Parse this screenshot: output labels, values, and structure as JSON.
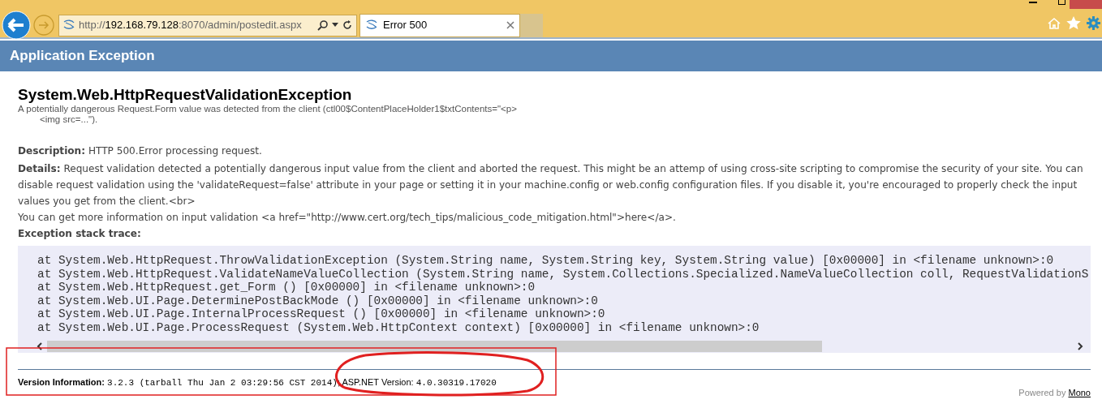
{
  "browser": {
    "address": {
      "scheme": "http://",
      "host": "192.168.79.128",
      "rest": ":8070/admin/postedit.aspx"
    },
    "tabs": [
      {
        "label": "Error 500",
        "selected": true
      }
    ]
  },
  "header": {
    "title": "Application Exception"
  },
  "exception": {
    "name": "System.Web.HttpRequestValidationException",
    "message_lines": [
      "A potentially dangerous Request.Form value was detected from the client (ctl00$ContentPlaceHolder1$txtContents=\"<p>",
      "<img src=...\")."
    ]
  },
  "description": {
    "label": "Description:",
    "text": "HTTP 500.Error processing request."
  },
  "details": {
    "label": "Details:",
    "text": "Request validation detected a potentially dangerous input value from the client and aborted the request. This might be an attemp of using cross-site scripting to compromise the security of your site. You can disable request validation using the 'validateRequest=false' attribute in your page or setting it in your machine.config or web.config configuration files. If you disable it, you're encouraged to properly check the input values you get from the client.<br>",
    "more": "You can get more information on input validation <a href=\"http://www.cert.org/tech_tips/malicious_code_mitigation.html\">here</a>."
  },
  "stack_trace": {
    "label": "Exception stack trace:",
    "lines": [
      "at System.Web.HttpRequest.ThrowValidationException (System.String name, System.String key, System.String value) [0x00000] in <filename unknown>:0",
      "at System.Web.HttpRequest.ValidateNameValueCollection (System.String name, System.Collections.Specialized.NameValueCollection coll, RequestValidationS",
      "at System.Web.HttpRequest.get_Form () [0x00000] in <filename unknown>:0",
      "at System.Web.UI.Page.DeterminePostBackMode () [0x00000] in <filename unknown>:0",
      "at System.Web.UI.Page.InternalProcessRequest () [0x00000] in <filename unknown>:0",
      "at System.Web.UI.Page.ProcessRequest (System.Web.HttpContext context) [0x00000] in <filename unknown>:0"
    ]
  },
  "version": {
    "label": "Version Information:",
    "mono_version": "3.2.3 (tarball Thu Jan 2 03:29:56 CST 2014)",
    "aspnet_label": "; ASP.NET Version:",
    "aspnet_version": "4.0.30319.17020"
  },
  "footer": {
    "text": "Powered by",
    "link": "Mono"
  }
}
